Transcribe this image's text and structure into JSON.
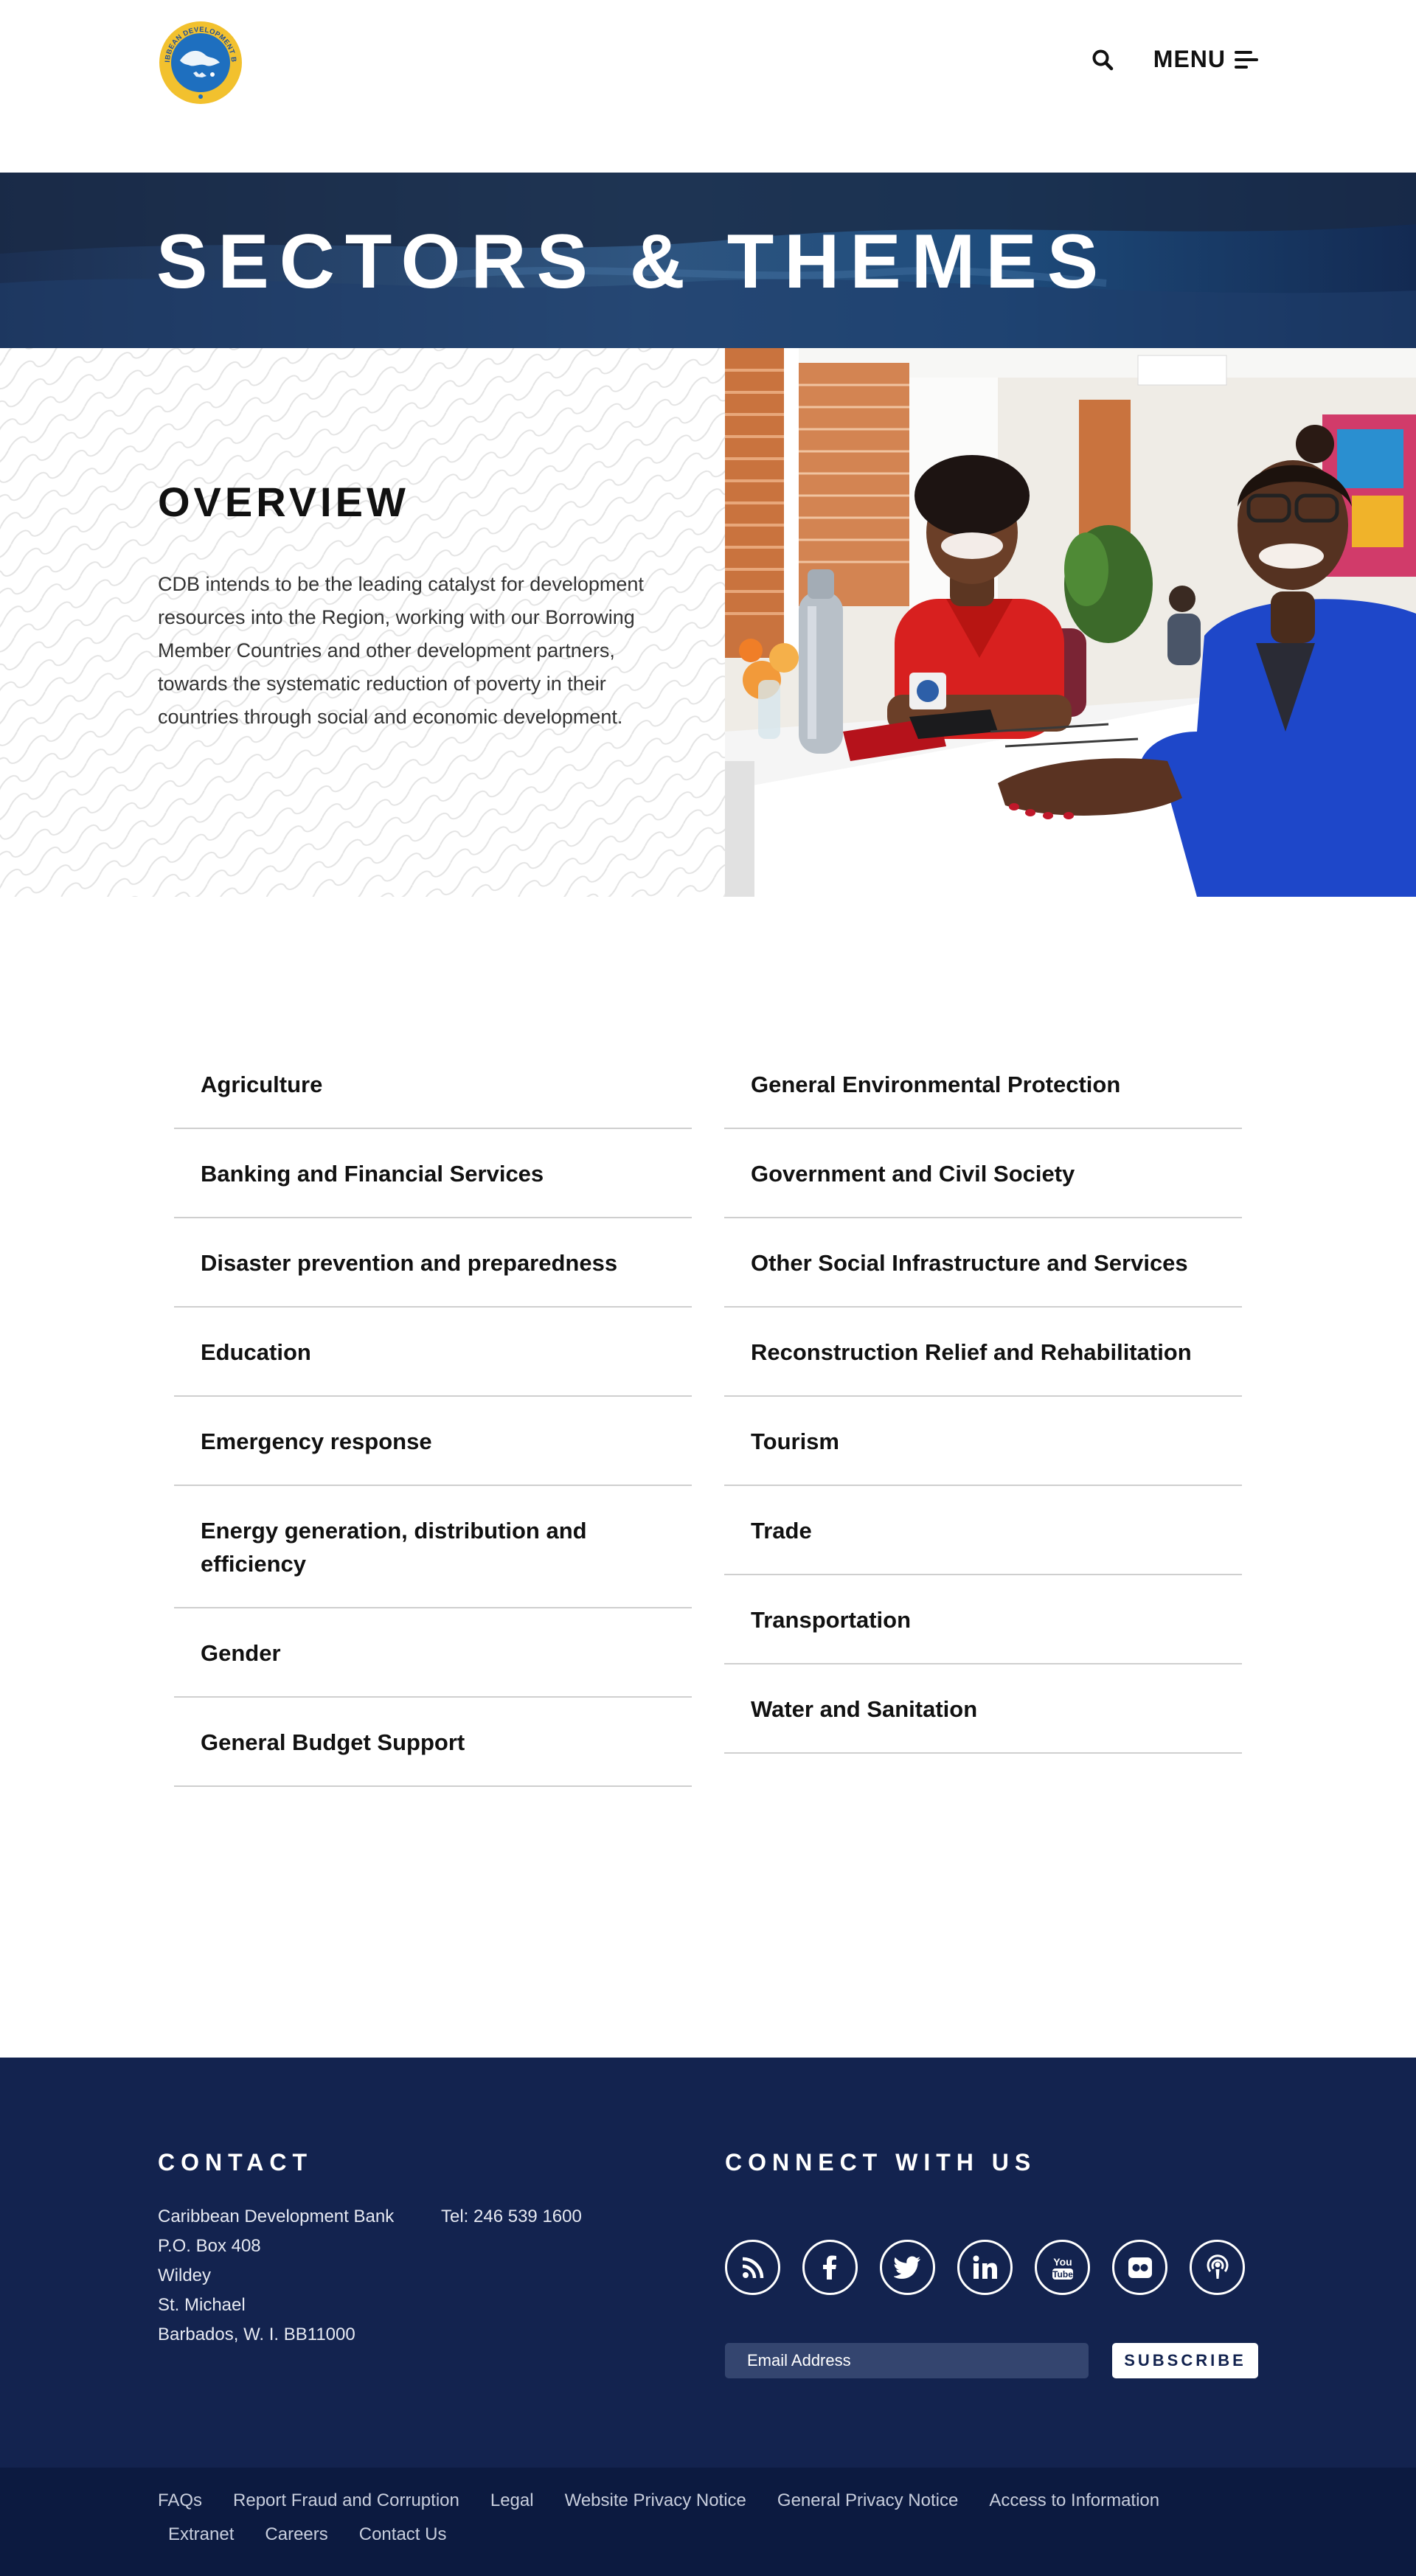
{
  "header": {
    "logo_text": "CARIBBEAN DEVELOPMENT BANK",
    "menu_label": "MENU",
    "search_icon": "search-icon",
    "menu_icon": "hamburger-icon"
  },
  "hero": {
    "title": "SECTORS & THEMES"
  },
  "overview": {
    "title": "OVERVIEW",
    "text": "CDB intends to be the leading catalyst for development resources into the Region, working with our Borrowing Member Countries and other development partners, towards the systematic reduction of poverty in their countries through social and economic development.",
    "slider_active_index": 1,
    "slider_count": 2
  },
  "sectors": {
    "left": [
      "Agriculture",
      "Banking and Financial Services",
      "Disaster prevention and preparedness",
      "Education",
      "Emergency response",
      "Energy generation, distribution and efficiency",
      "Gender",
      "General Budget Support"
    ],
    "right": [
      "General Environmental Protection",
      "Government and Civil Society",
      "Other Social Infrastructure and Services",
      "Reconstruction Relief and Rehabilitation",
      "Tourism",
      "Trade",
      "Transportation",
      "Water and Sanitation"
    ]
  },
  "footer": {
    "contact_heading": "CONTACT",
    "address": {
      "line1": "Caribbean Development Bank",
      "line2": "P.O. Box 408",
      "line3": "Wildey",
      "line4": "St. Michael",
      "line5": "Barbados, W. I. BB11000"
    },
    "tel": "Tel: 246 539 1600",
    "connect_heading": "CONNECT WITH US",
    "social_icons": [
      "rss-icon",
      "facebook-icon",
      "twitter-icon",
      "linkedin-icon",
      "youtube-icon",
      "flickr-icon",
      "podcast-icon"
    ],
    "email_placeholder": "Email Address",
    "subscribe_label": "SUBSCRIBE"
  },
  "bottom_links": [
    "FAQs",
    "Report Fraud and Corruption",
    "Legal",
    "Website Privacy Notice",
    "General Privacy Notice",
    "Access to Information",
    "Extranet",
    "Careers",
    "Contact Us"
  ],
  "colors": {
    "footer_bg": "#13234f",
    "bottom_bar_bg": "#0c1a40",
    "hero_bg": "#23385e",
    "logo_blue": "#1e6fbf",
    "logo_gold": "#f2c12e"
  }
}
